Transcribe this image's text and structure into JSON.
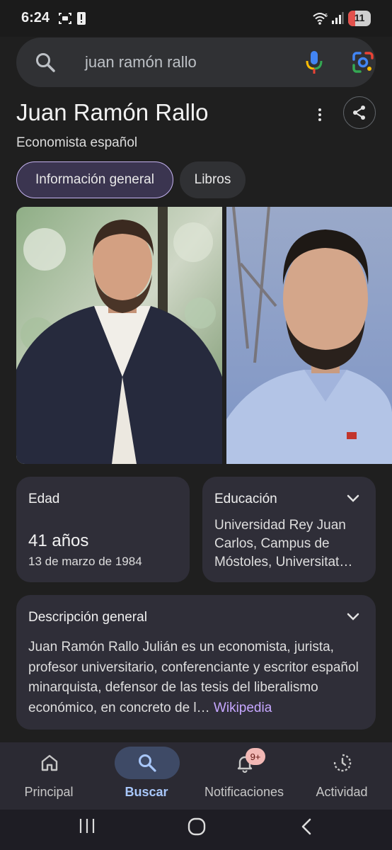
{
  "status_bar": {
    "time": "6:24",
    "battery": "11"
  },
  "search": {
    "query": "juan ramón rallo"
  },
  "entity": {
    "title": "Juan Ramón Rallo",
    "subtitle": "Economista español"
  },
  "tabs": [
    {
      "label": "Información general",
      "selected": true
    },
    {
      "label": "Libros",
      "selected": false
    }
  ],
  "facts": {
    "age": {
      "label": "Edad",
      "value": "41 años",
      "detail": "13 de marzo de 1984"
    },
    "education": {
      "label": "Educación",
      "value": "Universidad Rey Juan Carlos, Campus de Móstoles, Universitat…"
    }
  },
  "description": {
    "label": "Descripción general",
    "text": "Juan Ramón Rallo Julián es un economista, jurista, profesor universitario, conferenciante y escritor español minarquista,  defensor de las tesis del liberalismo económico, en concreto de l…",
    "source": "Wikipedia"
  },
  "bottom_nav": [
    {
      "label": "Principal",
      "icon": "home-icon",
      "active": false
    },
    {
      "label": "Buscar",
      "icon": "search-icon",
      "active": true
    },
    {
      "label": "Notificaciones",
      "icon": "bell-icon",
      "active": false,
      "badge": "9+"
    },
    {
      "label": "Actividad",
      "icon": "history-icon",
      "active": false
    }
  ],
  "colors": {
    "accent": "#a8c7fa",
    "chip_selected": "#3b3550",
    "link": "#c6a7ff",
    "badge": "#f2b8b5"
  }
}
